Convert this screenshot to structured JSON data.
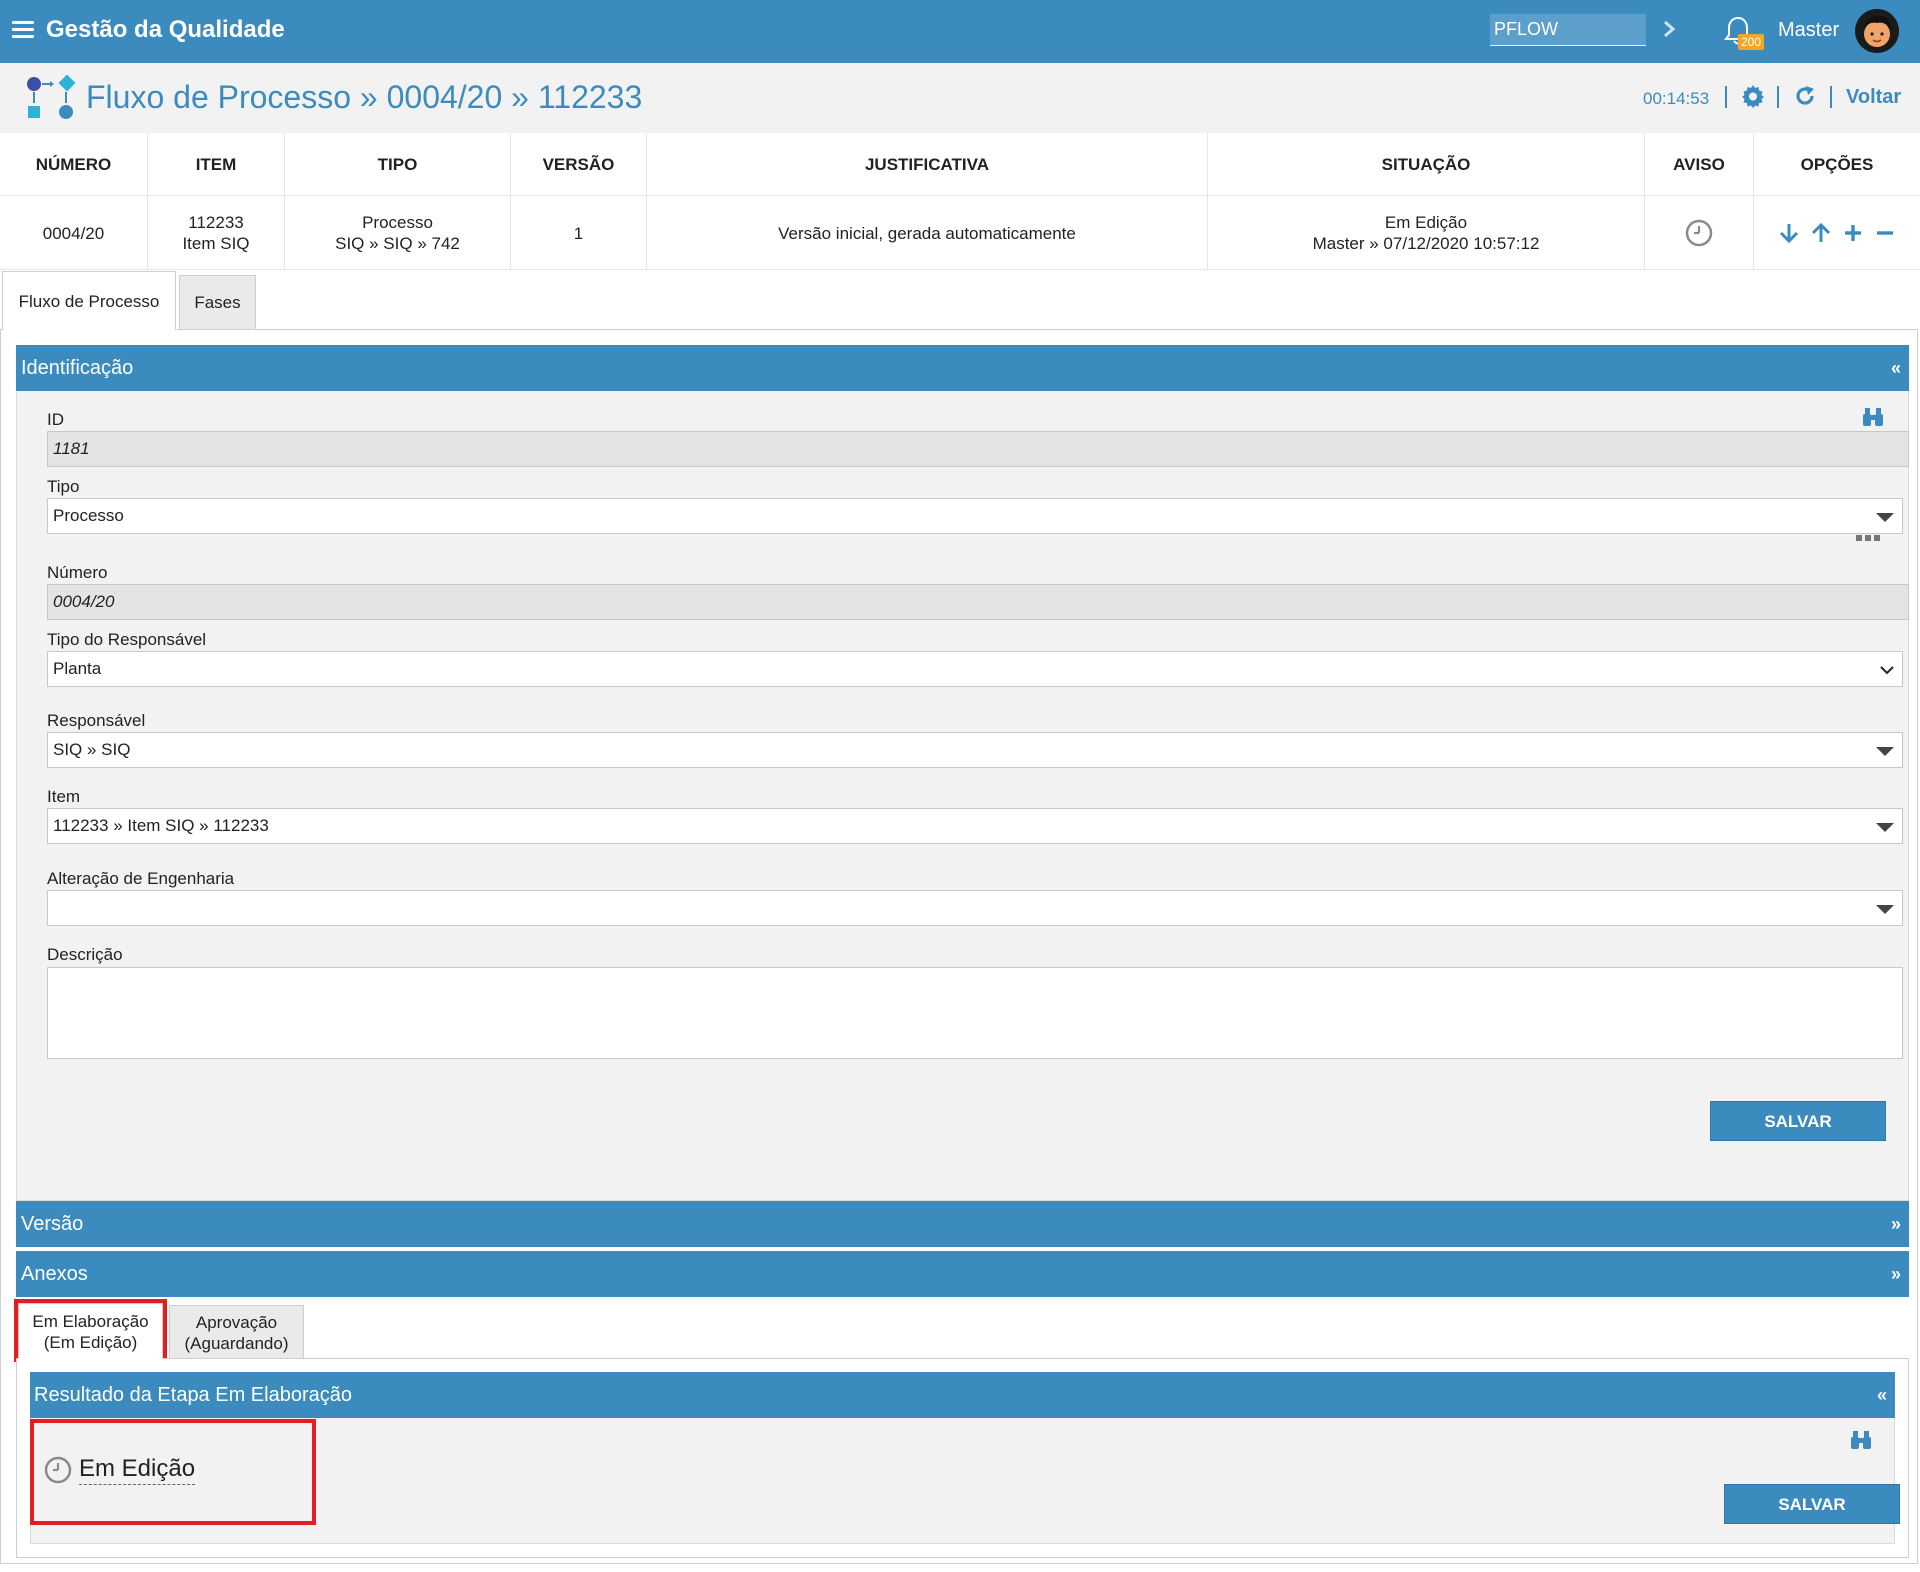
{
  "topbar": {
    "app_title": "Gestão da Qualidade",
    "search_value": "PFLOW",
    "notification_count": "200",
    "user_name": "Master"
  },
  "header": {
    "title": "Fluxo de Processo » 0004/20 » 112233",
    "timer": "00:14:53",
    "back_label": "Voltar"
  },
  "summary": {
    "headers": [
      "NÚMERO",
      "ITEM",
      "TIPO",
      "VERSÃO",
      "JUSTIFICATIVA",
      "SITUAÇÃO",
      "AVISO",
      "OPÇÕES"
    ],
    "numero": "0004/20",
    "item_line1": "112233",
    "item_line2": "Item SIQ",
    "tipo_line1": "Processo",
    "tipo_line2": "SIQ » SIQ » 742",
    "versao": "1",
    "justificativa": "Versão inicial, gerada automaticamente",
    "situacao_line1": "Em Edição",
    "situacao_line2": "Master » 07/12/2020 10:57:12"
  },
  "tabs": [
    {
      "label": "Fluxo de Processo",
      "active": true
    },
    {
      "label": "Fases",
      "active": false
    }
  ],
  "identificacao": {
    "title": "Identificação",
    "fields": {
      "id": {
        "label": "ID",
        "value": "1181"
      },
      "tipo": {
        "label": "Tipo",
        "value": "Processo"
      },
      "numero": {
        "label": "Número",
        "value": "0004/20"
      },
      "tipo_responsavel": {
        "label": "Tipo do Responsável",
        "value": "Planta"
      },
      "responsavel": {
        "label": "Responsável",
        "value": "SIQ » SIQ"
      },
      "item": {
        "label": "Item",
        "value": "112233 » Item SIQ » 112233"
      },
      "alteracao": {
        "label": "Alteração de Engenharia",
        "value": ""
      },
      "descricao": {
        "label": "Descrição",
        "value": ""
      }
    },
    "save_label": "SALVAR"
  },
  "sections": {
    "versao": "Versão",
    "anexos": "Anexos"
  },
  "stage_tabs": [
    {
      "line1": "Em Elaboração",
      "line2": "(Em Edição)",
      "active": true
    },
    {
      "line1": "Aprovação",
      "line2": "(Aguardando)",
      "active": false
    }
  ],
  "resultado": {
    "title": "Resultado da Etapa Em Elaboração",
    "status": "Em Edição",
    "save_label": "SALVAR"
  },
  "colors": {
    "primary": "#3b8bbf",
    "badge": "#f5a623",
    "highlight": "#e02020"
  }
}
